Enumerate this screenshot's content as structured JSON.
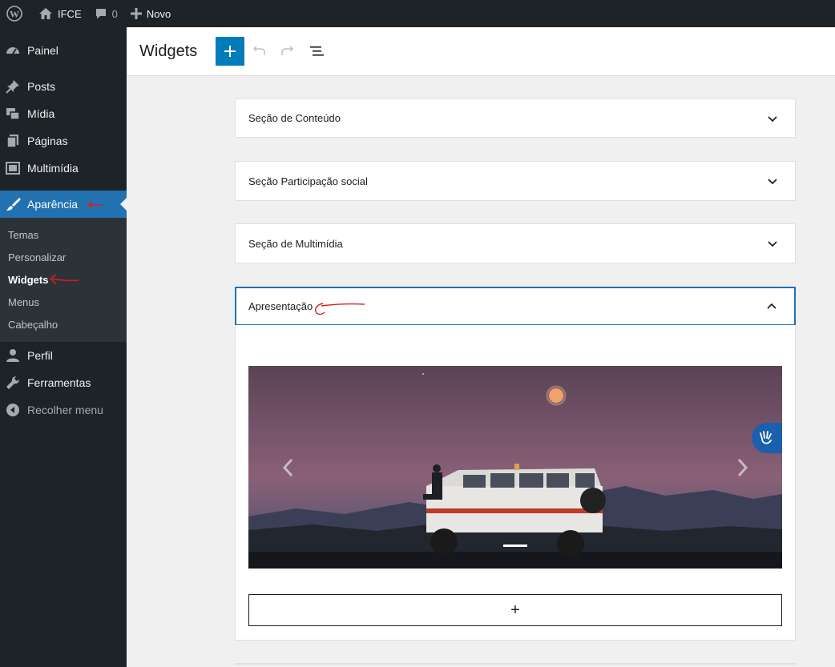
{
  "adminbar": {
    "site_name": "IFCE",
    "comments_count": "0",
    "new_label": "Novo"
  },
  "sidebar": {
    "items": [
      {
        "label": "Painel",
        "icon": "dashboard-icon"
      },
      {
        "label": "Posts",
        "icon": "pin-icon"
      },
      {
        "label": "Mídia",
        "icon": "media-icon"
      },
      {
        "label": "Páginas",
        "icon": "pages-icon"
      },
      {
        "label": "Multimídia",
        "icon": "gallery-icon"
      },
      {
        "label": "Aparência",
        "icon": "brush-icon"
      },
      {
        "label": "Perfil",
        "icon": "user-icon"
      },
      {
        "label": "Ferramentas",
        "icon": "wrench-icon"
      },
      {
        "label": "Recolher menu",
        "icon": "collapse-icon"
      }
    ],
    "submenu": [
      "Temas",
      "Personalizar",
      "Widgets",
      "Menus",
      "Cabeçalho"
    ]
  },
  "header": {
    "title": "Widgets"
  },
  "widget_areas": [
    {
      "label": "Seção de Conteúdo",
      "expanded": false
    },
    {
      "label": "Seção Participação social",
      "expanded": false
    },
    {
      "label": "Seção de Multimídia",
      "expanded": false
    },
    {
      "label": "Apresentação",
      "expanded": true
    }
  ],
  "add_block_label": "+",
  "colors": {
    "accent": "#2271b1",
    "admin_bg": "#1d2327",
    "annotation": "#d61f1f"
  }
}
